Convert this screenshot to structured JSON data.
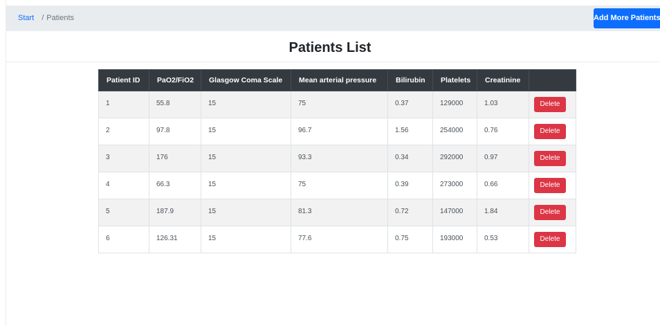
{
  "breadcrumb": {
    "start": "Start",
    "separator": "/",
    "current": "Patients"
  },
  "header": {
    "add_button": "Add More Patients"
  },
  "page": {
    "title": "Patients List"
  },
  "table": {
    "columns": [
      "Patient ID",
      "PaO2/FiO2",
      "Glasgow Coma Scale",
      "Mean arterial pressure",
      "Bilirubin",
      "Platelets",
      "Creatinine",
      ""
    ],
    "delete_label": "Delete",
    "rows": [
      {
        "id": "1",
        "pao2_fio2": "55.8",
        "gcs": "15",
        "map": "75",
        "bilirubin": "0.37",
        "platelets": "129000",
        "creatinine": "1.03"
      },
      {
        "id": "2",
        "pao2_fio2": "97.8",
        "gcs": "15",
        "map": "96.7",
        "bilirubin": "1.56",
        "platelets": "254000",
        "creatinine": "0.76"
      },
      {
        "id": "3",
        "pao2_fio2": "176",
        "gcs": "15",
        "map": "93.3",
        "bilirubin": "0.34",
        "platelets": "292000",
        "creatinine": "0.97"
      },
      {
        "id": "4",
        "pao2_fio2": "66.3",
        "gcs": "15",
        "map": "75",
        "bilirubin": "0.39",
        "platelets": "273000",
        "creatinine": "0.66"
      },
      {
        "id": "5",
        "pao2_fio2": "187.9",
        "gcs": "15",
        "map": "81.3",
        "bilirubin": "0.72",
        "platelets": "147000",
        "creatinine": "1.84"
      },
      {
        "id": "6",
        "pao2_fio2": "126.31",
        "gcs": "15",
        "map": "77.6",
        "bilirubin": "0.75",
        "platelets": "193000",
        "creatinine": "0.53"
      }
    ]
  },
  "colors": {
    "primary": "#0d6efd",
    "danger": "#dc3545",
    "table_header": "#343a40",
    "breadcrumb_bar": "#e9ecef"
  }
}
